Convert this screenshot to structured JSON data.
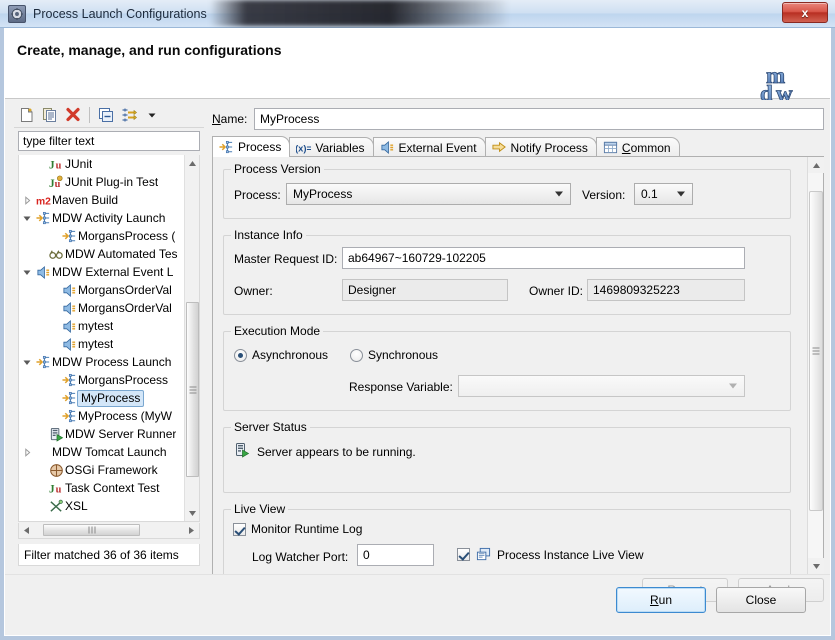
{
  "window": {
    "title": "Process Launch Configurations",
    "close_label": "x",
    "app_icon": "gear-icon"
  },
  "header": {
    "title": "Create, manage, and run configurations",
    "logo": "mdw-logo"
  },
  "tree_toolbar": {
    "buttons": [
      {
        "name": "new-configuration-icon",
        "label": "New launch configuration"
      },
      {
        "name": "duplicate-configuration-icon",
        "label": "Duplicate"
      },
      {
        "name": "delete-configuration-icon",
        "label": "Delete"
      },
      {
        "name": "collapse-all-icon",
        "label": "Collapse All"
      },
      {
        "name": "filter-icon",
        "label": "Filter"
      },
      {
        "name": "view-menu-chevron-down-icon",
        "label": "View Menu"
      }
    ]
  },
  "filter": {
    "placeholder": "type filter text",
    "value": "",
    "status": "Filter matched 36 of 36 items"
  },
  "tree": {
    "items": [
      {
        "label": "JUnit",
        "indent": 1,
        "arrow": "none",
        "icon": "junit-icon",
        "selected": false
      },
      {
        "label": "JUnit Plug-in Test",
        "indent": 1,
        "arrow": "none",
        "icon": "junit-plugin-icon",
        "selected": false
      },
      {
        "label": "Maven Build",
        "indent": 0,
        "arrow": "collapsed",
        "icon": "maven-icon",
        "selected": false
      },
      {
        "label": "MDW Activity Launch",
        "indent": 0,
        "arrow": "expanded",
        "icon": "mdw-activity-icon",
        "selected": false
      },
      {
        "label": "MorgansProcess (",
        "indent": 2,
        "arrow": "none",
        "icon": "mdw-activity-icon",
        "selected": false
      },
      {
        "label": "MDW Automated Tes",
        "indent": 1,
        "arrow": "none",
        "icon": "mdw-test-icon",
        "selected": false
      },
      {
        "label": "MDW External Event L",
        "indent": 0,
        "arrow": "expanded",
        "icon": "mdw-event-icon",
        "selected": false
      },
      {
        "label": "MorgansOrderVal",
        "indent": 2,
        "arrow": "none",
        "icon": "mdw-event-icon",
        "selected": false
      },
      {
        "label": "MorgansOrderVal",
        "indent": 2,
        "arrow": "none",
        "icon": "mdw-event-icon",
        "selected": false
      },
      {
        "label": "mytest",
        "indent": 2,
        "arrow": "none",
        "icon": "mdw-event-icon",
        "selected": false
      },
      {
        "label": "mytest",
        "indent": 2,
        "arrow": "none",
        "icon": "mdw-event-icon",
        "selected": false
      },
      {
        "label": "MDW Process Launch",
        "indent": 0,
        "arrow": "expanded",
        "icon": "mdw-process-icon",
        "selected": false
      },
      {
        "label": "MorgansProcess",
        "indent": 2,
        "arrow": "none",
        "icon": "mdw-process-icon",
        "selected": false
      },
      {
        "label": "MyProcess",
        "indent": 2,
        "arrow": "none",
        "icon": "mdw-process-icon",
        "selected": true
      },
      {
        "label": "MyProcess (MyW",
        "indent": 2,
        "arrow": "none",
        "icon": "mdw-process-icon",
        "selected": false
      },
      {
        "label": "MDW Server Runner",
        "indent": 1,
        "arrow": "none",
        "icon": "mdw-server-icon",
        "selected": false
      },
      {
        "label": "MDW Tomcat Launch",
        "indent": 0,
        "arrow": "collapsed",
        "icon": "none",
        "selected": false
      },
      {
        "label": "OSGi Framework",
        "indent": 1,
        "arrow": "none",
        "icon": "osgi-icon",
        "selected": false
      },
      {
        "label": "Task Context Test",
        "indent": 1,
        "arrow": "none",
        "icon": "junit-icon",
        "selected": false
      },
      {
        "label": "XSL",
        "indent": 1,
        "arrow": "none",
        "icon": "xsl-icon",
        "selected": false
      }
    ]
  },
  "config": {
    "name_label": "Name:",
    "name_value": "MyProcess"
  },
  "tabs": [
    {
      "label": "Process",
      "icon": "mdw-process-icon",
      "active": true
    },
    {
      "label": "Variables",
      "icon": "variables-icon",
      "active": false
    },
    {
      "label": "External Event",
      "icon": "mdw-event-icon",
      "active": false
    },
    {
      "label": "Notify Process",
      "icon": "notify-arrow-icon",
      "active": false
    },
    {
      "label": "Common",
      "icon": "common-table-icon",
      "active": false
    }
  ],
  "process_version": {
    "group_label": "Process Version",
    "process_label": "Process:",
    "process_value": "MyProcess",
    "version_label": "Version:",
    "version_value": "0.1"
  },
  "instance_info": {
    "group_label": "Instance Info",
    "master_request_id_label": "Master Request ID:",
    "master_request_id_value": "ab64967~160729-102205",
    "owner_label": "Owner:",
    "owner_value": "Designer",
    "owner_id_label": "Owner ID:",
    "owner_id_value": "1469809325223"
  },
  "execution_mode": {
    "group_label": "Execution Mode",
    "asynchronous_label": "Asynchronous",
    "asynchronous_checked": true,
    "synchronous_label": "Synchronous",
    "synchronous_checked": false,
    "response_variable_label": "Response Variable:",
    "response_variable_value": ""
  },
  "server_status": {
    "group_label": "Server Status",
    "status_text": "Server appears to be running.",
    "status_icon": "server-running-icon"
  },
  "live_view": {
    "group_label": "Live View",
    "monitor_runtime_log_label": "Monitor Runtime Log",
    "monitor_runtime_log_checked": true,
    "log_watcher_port_label": "Log Watcher Port:",
    "log_watcher_port_value": "0",
    "process_instance_live_view_label": "Process Instance Live View",
    "process_instance_live_view_checked": true,
    "process_instance_live_view_icon": "live-view-icon"
  },
  "footer": {
    "revert_label": "Revert",
    "apply_label": "Apply",
    "run_label": "Run",
    "close_label": "Close"
  },
  "colors": {
    "accent": "#3c8ad0",
    "selection": "#d3e6f8",
    "delete": "#d13a2a",
    "logo": "#4f7fc0"
  }
}
